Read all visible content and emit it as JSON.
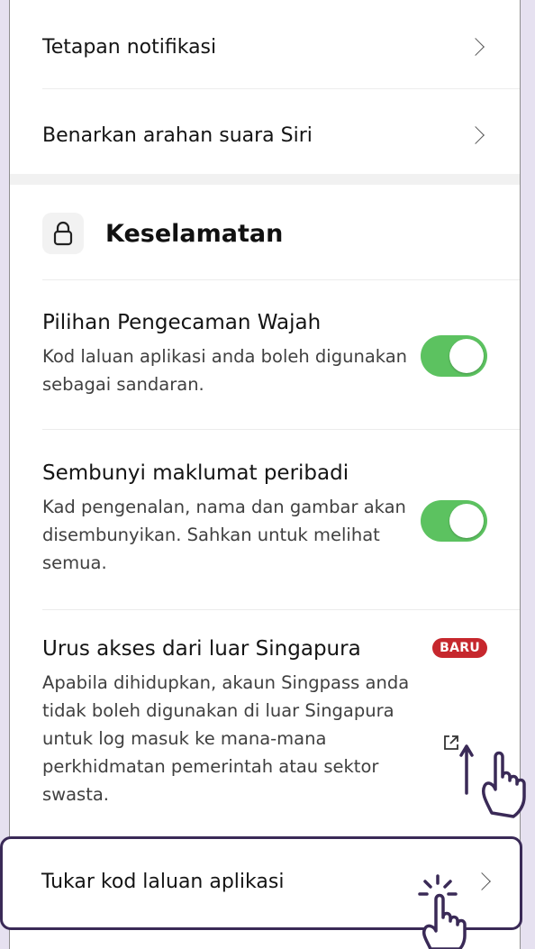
{
  "settings": {
    "notification_settings_label": "Tetapan notifikasi",
    "siri_label": "Benarkan arahan suara Siri"
  },
  "security": {
    "title": "Keselamatan",
    "face_id": {
      "title": "Pilihan Pengecaman Wajah",
      "description": "Kod laluan aplikasi anda boleh digunakan sebagai sandaran.",
      "enabled": true
    },
    "hide_info": {
      "title": "Sembunyi maklumat peribadi",
      "description": "Kad pengenalan, nama dan gambar akan disembunyikan. Sahkan untuk melihat semua.",
      "enabled": true
    },
    "overseas_access": {
      "title": "Urus akses dari luar Singapura",
      "badge": "BARU",
      "description": "Apabila dihidupkan, akaun Singpass anda tidak boleh digunakan di luar Singapura untuk log masuk ke mana-mana perkhidmatan pemerintah atau sektor swasta."
    },
    "change_passcode_label": "Tukar kod laluan aplikasi"
  },
  "colors": {
    "toggle_on": "#5cc260",
    "badge": "#c6272d",
    "highlight_border": "#3a2a57",
    "page_background": "#e6e1f0"
  },
  "icons": {
    "chevron": "chevron-right-icon",
    "lock": "lock-icon",
    "external": "external-link-icon",
    "pointer": "hand-pointer-icon"
  }
}
